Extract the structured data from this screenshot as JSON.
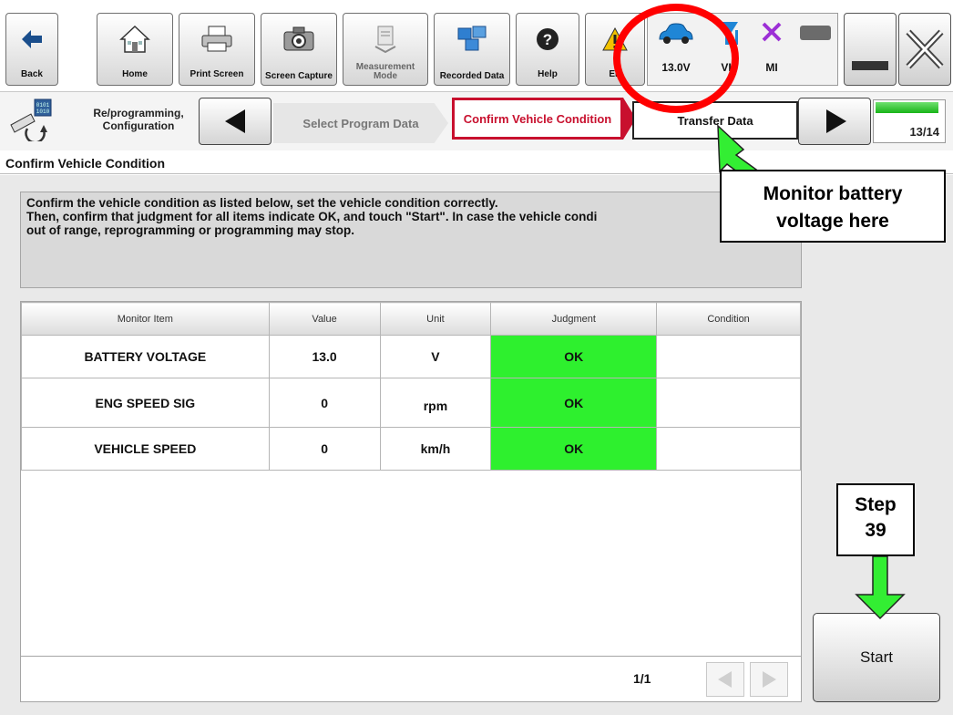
{
  "toolbar": {
    "buttons": [
      {
        "label": "Back",
        "icon": "back-arrow-icon"
      },
      {
        "label": "Home",
        "icon": "home-icon"
      },
      {
        "label": "Print Screen",
        "icon": "printer-icon"
      },
      {
        "label": "Screen Capture",
        "icon": "camera-icon"
      },
      {
        "label": "Measurement Mode",
        "icon": "measurement-icon"
      },
      {
        "label": "Recorded Data",
        "icon": "recorded-data-icon"
      },
      {
        "label": "Help",
        "icon": "help-icon"
      },
      {
        "label": "EP",
        "icon": "warning-icon"
      }
    ],
    "status": {
      "voltage": "13.0V",
      "vi": "VI",
      "mi": "MI"
    }
  },
  "nav": {
    "title": "Re/programming, Configuration",
    "steps": [
      "Select Program Data",
      "Confirm Vehicle Condition",
      "Transfer Data"
    ],
    "progress": "13/14",
    "progress_fraction": 0.93
  },
  "section_title": "Confirm Vehicle Condition",
  "message": {
    "line1": "Confirm the vehicle condition as listed below, set the vehicle condition correctly.",
    "line2": "Then, confirm that judgment for all items indicate OK, and touch \"Start\". In case the vehicle condi",
    "line3": "out of range, reprogramming or programming may stop."
  },
  "table": {
    "headers": [
      "Monitor Item",
      "Value",
      "Unit",
      "Judgment",
      "Condition"
    ],
    "rows": [
      [
        "BATTERY VOLTAGE",
        "13.0",
        "V",
        "OK",
        ""
      ],
      [
        "ENG SPEED SIG",
        "0",
        "rpm",
        "OK",
        ""
      ],
      [
        "VEHICLE SPEED",
        "0",
        "km/h",
        "OK",
        ""
      ]
    ]
  },
  "pagination": {
    "indicator": "1/1"
  },
  "start_label": "Start",
  "annotations": {
    "monitor_line1": "Monitor battery",
    "monitor_line2": "voltage here",
    "step_line1": "Step",
    "step_line2": "39"
  },
  "colors": {
    "ok_green": "#2ef02e",
    "annotation_red": "#ff0000",
    "arrow_green": "#33ee33",
    "crumb_active": "#c8102e"
  }
}
